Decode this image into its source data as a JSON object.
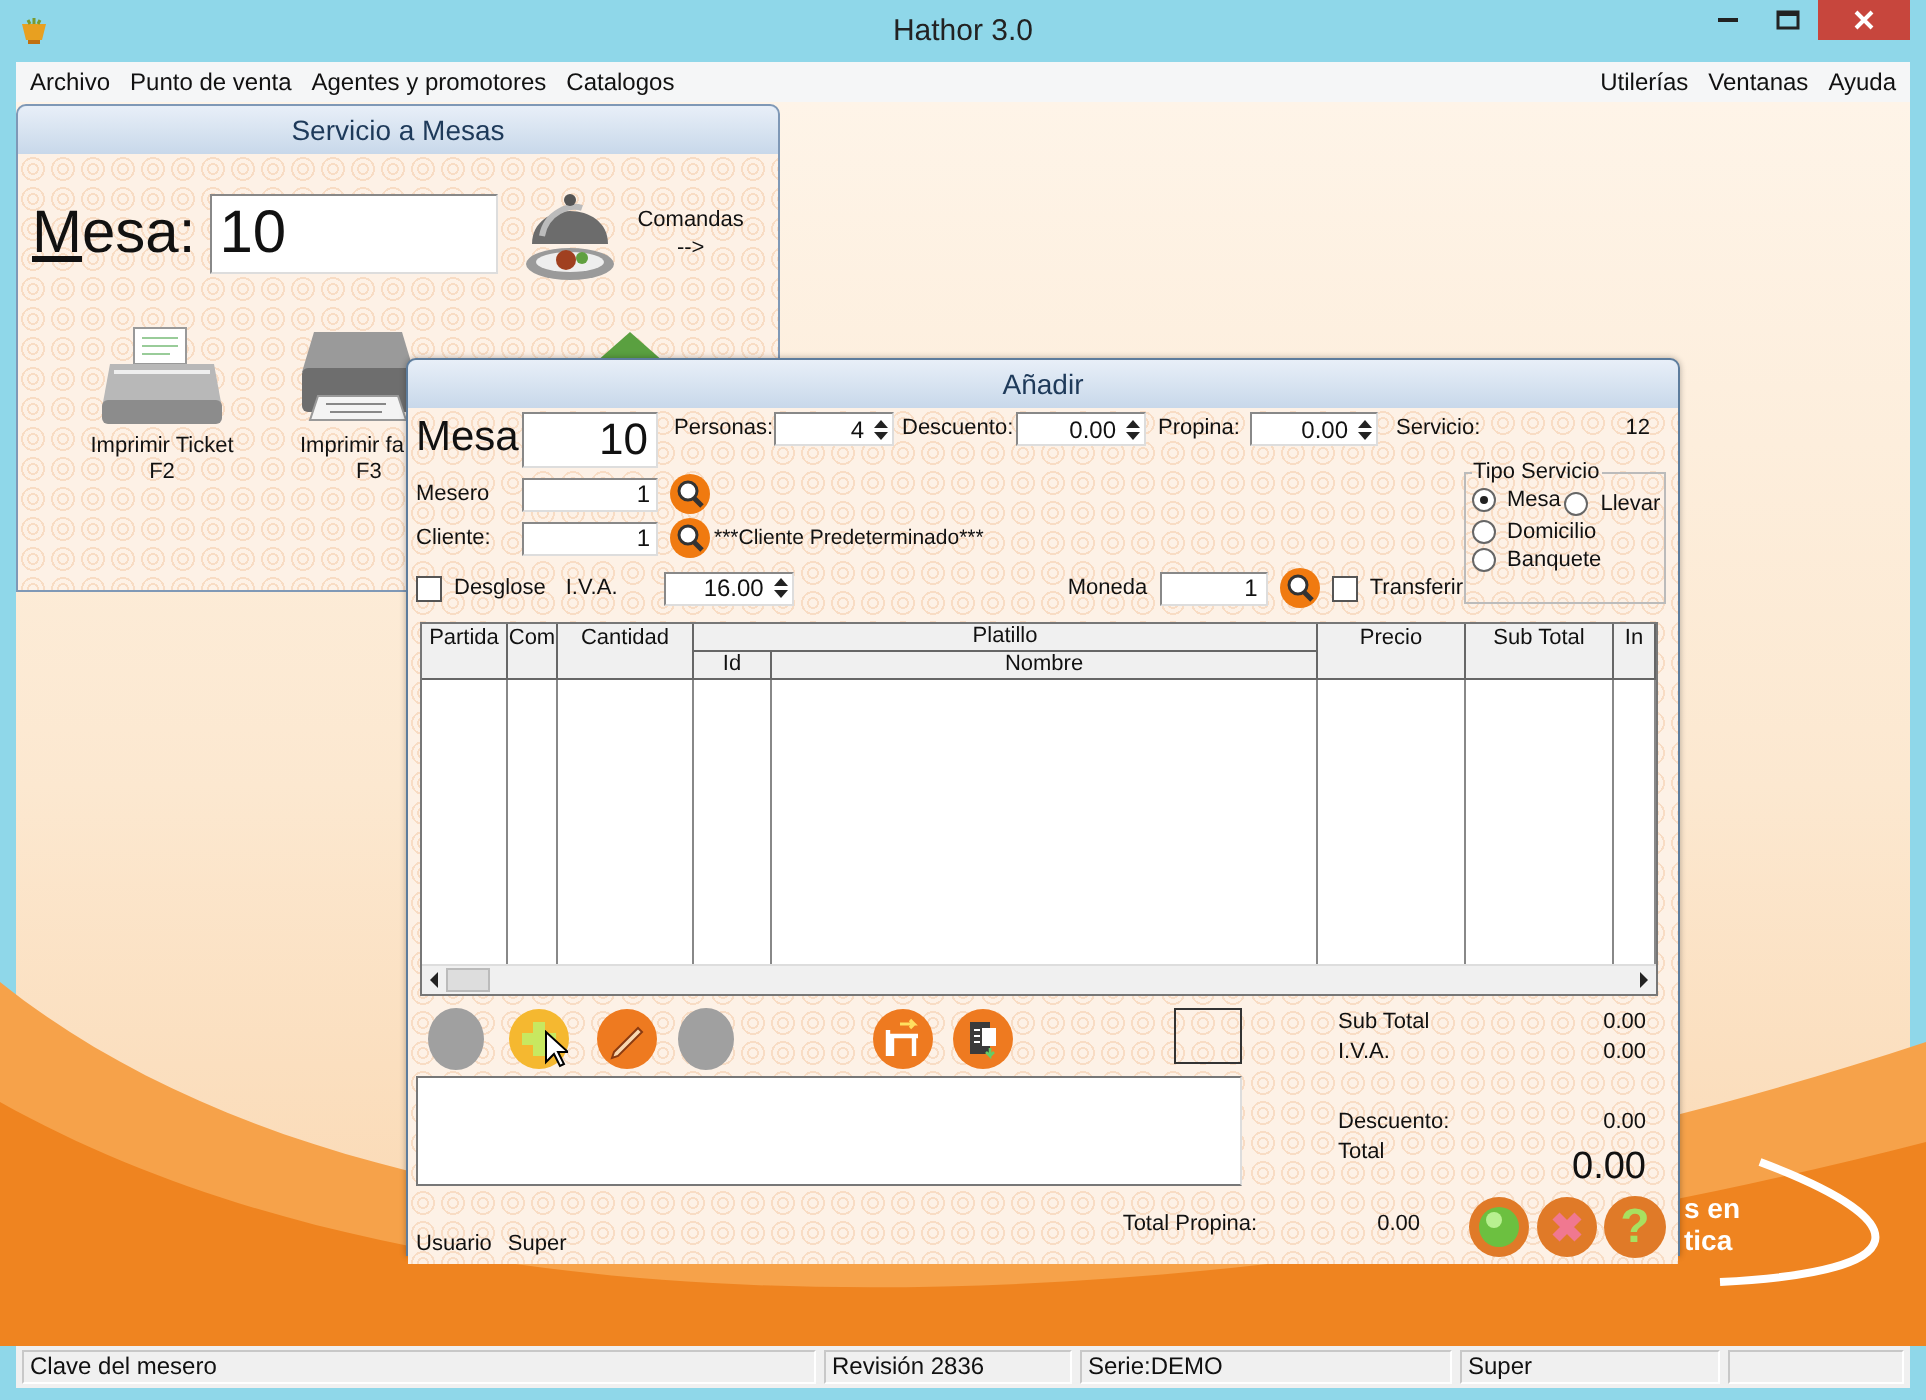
{
  "window": {
    "title": "Hathor 3.0"
  },
  "menu": {
    "left": [
      "Archivo",
      "Punto de venta",
      "Agentes y promotores",
      "Catalogos"
    ],
    "right": [
      "Utilerías",
      "Ventanas",
      "Ayuda"
    ]
  },
  "servicio_window": {
    "title": "Servicio a Mesas",
    "mesa_label": "Mesa:",
    "mesa_value": "10",
    "comandas": [
      "Comandas",
      "-->"
    ],
    "actions": [
      {
        "kind": "ticket",
        "label": "Imprimir Ticket",
        "key": "F2"
      },
      {
        "kind": "printer",
        "label": "Imprimir fa",
        "key": "F3"
      }
    ]
  },
  "anadir_window": {
    "title": "Añadir",
    "mesa_label": "Mesa",
    "mesa_value": "10",
    "spinners": [
      {
        "label": "Personas:",
        "value": "4"
      },
      {
        "label": "Descuento:",
        "value": "0.00"
      },
      {
        "label": "Propina:",
        "value": "0.00"
      }
    ],
    "servicio": {
      "label": "Servicio:",
      "value": "12"
    },
    "mesero": {
      "label": "Mesero",
      "value": "1"
    },
    "cliente": {
      "label": "Cliente:",
      "value": "1",
      "name": "***Cliente Predeterminado***"
    },
    "desglose": {
      "label": "Desglose",
      "checked": false
    },
    "iva": {
      "label": "I.V.A.",
      "value": "16.00"
    },
    "moneda": {
      "label": "Moneda",
      "value": "1"
    },
    "transferir": {
      "label": "Transferir",
      "checked": false
    },
    "tipo_servicio": {
      "title": "Tipo Servicio",
      "options": [
        {
          "label": "Mesa",
          "selected": true
        },
        {
          "label": "Llevar",
          "selected": false
        },
        {
          "label": "Domicilio",
          "selected": false
        },
        {
          "label": "Banquete",
          "selected": false
        }
      ]
    },
    "table": {
      "columns": [
        {
          "label": "Partida"
        },
        {
          "label": "Com"
        },
        {
          "label": "Cantidad"
        },
        {
          "label": "Platillo",
          "children": [
            {
              "label": "Id"
            },
            {
              "label": "Nombre"
            }
          ]
        },
        {
          "label": "Precio"
        },
        {
          "label": "Sub Total"
        },
        {
          "label": "In"
        }
      ]
    },
    "toolbar": [
      {
        "kind": "blank"
      },
      {
        "kind": "add"
      },
      {
        "kind": "edit"
      },
      {
        "kind": "blank"
      },
      {
        "kind": "move-table"
      },
      {
        "kind": "notes"
      }
    ],
    "totals": [
      {
        "kind": "subtotal",
        "label": "Sub Total",
        "value": "0.00"
      },
      {
        "kind": "tax",
        "label": "I.V.A.",
        "value": "0.00"
      },
      {
        "kind": "discount",
        "label": "Descuento:",
        "value": "0.00"
      },
      {
        "kind": "total",
        "label": "Total",
        "value": "0.00"
      }
    ],
    "user": {
      "label": "Usuario",
      "value": "Super"
    },
    "tip_total": {
      "label": "Total Propina:",
      "value": "0.00"
    },
    "actions": [
      {
        "kind": "accept"
      },
      {
        "kind": "cancel"
      },
      {
        "kind": "help",
        "glyph": "?"
      }
    ]
  },
  "background_logo": [
    "s en",
    "tica"
  ],
  "status_bar": [
    "Clave del mesero",
    "Revisión 2836",
    "Serie:DEMO",
    "Super"
  ]
}
